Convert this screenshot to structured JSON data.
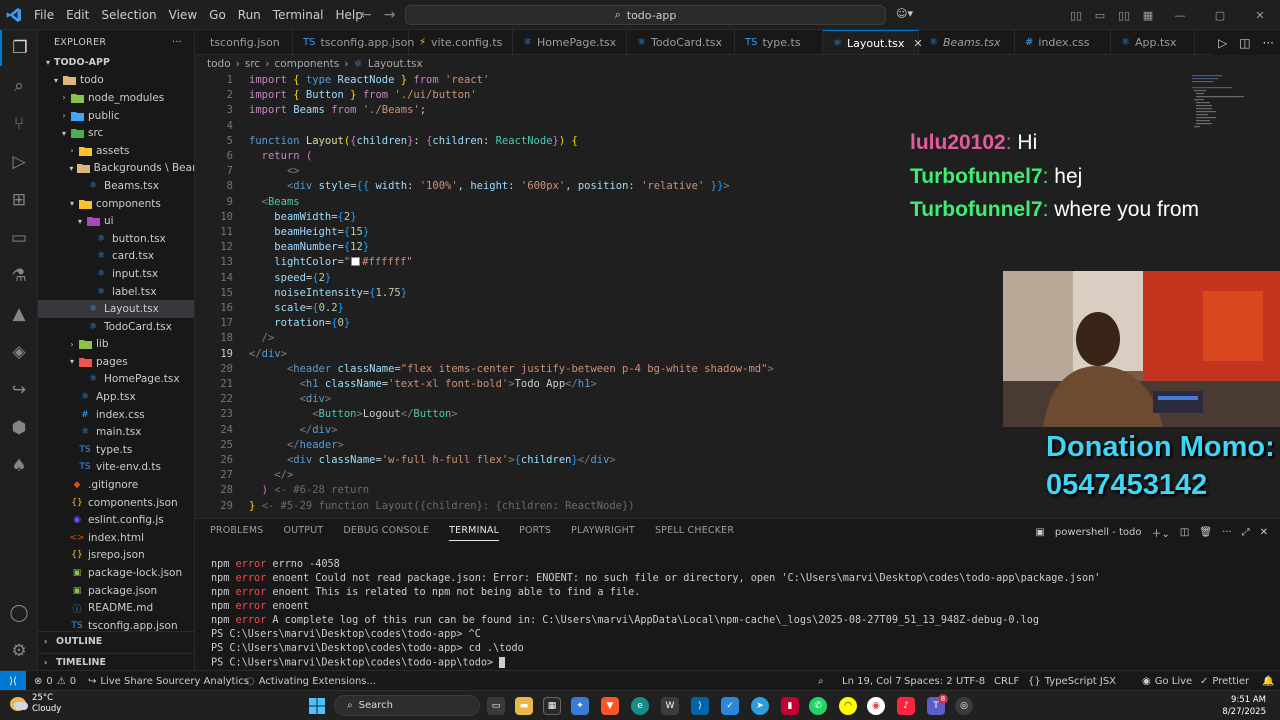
{
  "titlebar": {
    "menu": [
      "File",
      "Edit",
      "Selection",
      "View",
      "Go",
      "Run",
      "Terminal",
      "Help"
    ],
    "search": "todo-app"
  },
  "explorer": {
    "header": "EXPLORER",
    "project": "TODO-APP",
    "items": [
      {
        "label": "todo",
        "type": "folder",
        "open": true,
        "depth": 1,
        "color": "#dcb67a"
      },
      {
        "label": "node_modules",
        "type": "folder",
        "open": false,
        "depth": 2,
        "color": "#8bc34a"
      },
      {
        "label": "public",
        "type": "folder",
        "open": false,
        "depth": 2,
        "color": "#42a5f5"
      },
      {
        "label": "src",
        "type": "folder",
        "open": true,
        "depth": 2,
        "color": "#4caf50"
      },
      {
        "label": "assets",
        "type": "folder",
        "open": false,
        "depth": 3,
        "color": "#fbc02d"
      },
      {
        "label": "Backgrounds \\ Beams",
        "type": "folder",
        "open": true,
        "depth": 3,
        "color": "#dcb67a"
      },
      {
        "label": "Beams.tsx",
        "type": "file",
        "depth": 4,
        "color": "#3b9bf0",
        "glyph": "⚛"
      },
      {
        "label": "components",
        "type": "folder",
        "open": true,
        "depth": 3,
        "color": "#fbc02d"
      },
      {
        "label": "ui",
        "type": "folder",
        "open": true,
        "depth": 4,
        "color": "#ab47bc"
      },
      {
        "label": "button.tsx",
        "type": "file",
        "depth": 5,
        "color": "#3b9bf0",
        "glyph": "⚛"
      },
      {
        "label": "card.tsx",
        "type": "file",
        "depth": 5,
        "color": "#3b9bf0",
        "glyph": "⚛"
      },
      {
        "label": "input.tsx",
        "type": "file",
        "depth": 5,
        "color": "#3b9bf0",
        "glyph": "⚛"
      },
      {
        "label": "label.tsx",
        "type": "file",
        "depth": 5,
        "color": "#3b9bf0",
        "glyph": "⚛"
      },
      {
        "label": "Layout.tsx",
        "type": "file",
        "depth": 4,
        "color": "#3b9bf0",
        "glyph": "⚛",
        "selected": true
      },
      {
        "label": "TodoCard.tsx",
        "type": "file",
        "depth": 4,
        "color": "#3b9bf0",
        "glyph": "⚛"
      },
      {
        "label": "lib",
        "type": "folder",
        "open": false,
        "depth": 3,
        "color": "#8bc34a"
      },
      {
        "label": "pages",
        "type": "folder",
        "open": true,
        "depth": 3,
        "color": "#ef5350"
      },
      {
        "label": "HomePage.tsx",
        "type": "file",
        "depth": 4,
        "color": "#3b9bf0",
        "glyph": "⚛"
      },
      {
        "label": "App.tsx",
        "type": "file",
        "depth": 3,
        "color": "#3b9bf0",
        "glyph": "⚛"
      },
      {
        "label": "index.css",
        "type": "file",
        "depth": 3,
        "color": "#42a5f5",
        "glyph": "#"
      },
      {
        "label": "main.tsx",
        "type": "file",
        "depth": 3,
        "color": "#3b9bf0",
        "glyph": "⚛"
      },
      {
        "label": "type.ts",
        "type": "file",
        "depth": 3,
        "color": "#3b9bf0",
        "glyph": "TS"
      },
      {
        "label": "vite-env.d.ts",
        "type": "file",
        "depth": 3,
        "color": "#3b9bf0",
        "glyph": "TS"
      },
      {
        "label": ".gitignore",
        "type": "file",
        "depth": 2,
        "color": "#e64a19",
        "glyph": "◆"
      },
      {
        "label": "components.json",
        "type": "file",
        "depth": 2,
        "color": "#fbc02d",
        "glyph": "{}"
      },
      {
        "label": "eslint.config.js",
        "type": "file",
        "depth": 2,
        "color": "#7c4dff",
        "glyph": "◉"
      },
      {
        "label": "index.html",
        "type": "file",
        "depth": 2,
        "color": "#e65100",
        "glyph": "<>"
      },
      {
        "label": "jsrepo.json",
        "type": "file",
        "depth": 2,
        "color": "#fbc02d",
        "glyph": "{}"
      },
      {
        "label": "package-lock.json",
        "type": "file",
        "depth": 2,
        "color": "#8bc34a",
        "glyph": "▣"
      },
      {
        "label": "package.json",
        "type": "file",
        "depth": 2,
        "color": "#8bc34a",
        "glyph": "▣"
      },
      {
        "label": "README.md",
        "type": "file",
        "depth": 2,
        "color": "#42a5f5",
        "glyph": "ⓘ"
      },
      {
        "label": "tsconfig.app.json",
        "type": "file",
        "depth": 2,
        "color": "#3b9bf0",
        "glyph": "TS"
      }
    ],
    "outline": "OUTLINE",
    "timeline": "TIMELINE"
  },
  "tabs": [
    {
      "label": "tsconfig.json",
      "icon": "",
      "color": "#3b9bf0",
      "width": 98
    },
    {
      "label": "tsconfig.app.json",
      "icon": "TS",
      "color": "#3b9bf0",
      "width": 116
    },
    {
      "label": "vite.config.ts",
      "icon": "⚡",
      "color": "#fbc02d",
      "width": 104
    },
    {
      "label": "HomePage.tsx",
      "icon": "⚛",
      "color": "#3b9bf0",
      "width": 114
    },
    {
      "label": "TodoCard.tsx",
      "icon": "⚛",
      "color": "#3b9bf0",
      "width": 108
    },
    {
      "label": "type.ts",
      "icon": "TS",
      "color": "#3b9bf0",
      "width": 88
    },
    {
      "label": "Layout.tsx",
      "icon": "⚛",
      "color": "#3b9bf0",
      "width": 96,
      "active": true
    },
    {
      "label": "Beams.tsx",
      "icon": "⚛",
      "color": "#3b9bf0",
      "width": 96,
      "italic": true
    },
    {
      "label": "index.css",
      "icon": "#",
      "color": "#42a5f5",
      "width": 96
    },
    {
      "label": "App.tsx",
      "icon": "⚛",
      "color": "#3b9bf0",
      "width": 84
    }
  ],
  "breadcrumb": [
    "todo",
    "src",
    "components",
    "Layout.tsx"
  ],
  "editor": {
    "current_line": 19,
    "lines": [
      [
        [
          "kw",
          "import "
        ],
        [
          "br1",
          "{ "
        ],
        [
          "kb",
          "type "
        ],
        [
          "attr",
          "ReactNode"
        ],
        [
          "br1",
          " }"
        ],
        [
          "kw",
          " from "
        ],
        [
          "str",
          "'react'"
        ]
      ],
      [
        [
          "kw",
          "import "
        ],
        [
          "br1",
          "{ "
        ],
        [
          "attr",
          "Button"
        ],
        [
          "br1",
          " }"
        ],
        [
          "kw",
          " from "
        ],
        [
          "str",
          "'./ui/button'"
        ]
      ],
      [
        [
          "kw",
          "import "
        ],
        [
          "attr",
          "Beams"
        ],
        [
          "kw",
          " from "
        ],
        [
          "str",
          "'./Beams'"
        ],
        [
          "txt",
          ";"
        ]
      ],
      [],
      [
        [
          "kb",
          "function "
        ],
        [
          "fn",
          "Layout"
        ],
        [
          "br1",
          "("
        ],
        [
          "br2",
          "{"
        ],
        [
          "attr",
          "children"
        ],
        [
          "br2",
          "}"
        ],
        [
          "txt",
          ": "
        ],
        [
          "br2",
          "{"
        ],
        [
          "attr",
          "children"
        ],
        [
          "txt",
          ": "
        ],
        [
          "cmp",
          "ReactNode"
        ],
        [
          "br2",
          "}"
        ],
        [
          "br1",
          ")"
        ],
        [
          "txt",
          " "
        ],
        [
          "br1",
          "{"
        ]
      ],
      [
        [
          "txt",
          "  "
        ],
        [
          "kw",
          "return "
        ],
        [
          "br2",
          "("
        ]
      ],
      [
        [
          "txt",
          "      "
        ],
        [
          "gray",
          "<>"
        ]
      ],
      [
        [
          "txt",
          "      "
        ],
        [
          "gray",
          "<"
        ],
        [
          "tag",
          "div"
        ],
        [
          "txt",
          " "
        ],
        [
          "attr",
          "style"
        ],
        [
          "txt",
          "="
        ],
        [
          "br3",
          "{{ "
        ],
        [
          "attr",
          "width"
        ],
        [
          "txt",
          ": "
        ],
        [
          "str",
          "'100%'"
        ],
        [
          "txt",
          ", "
        ],
        [
          "attr",
          "height"
        ],
        [
          "txt",
          ": "
        ],
        [
          "str",
          "'600px'"
        ],
        [
          "txt",
          ", "
        ],
        [
          "attr",
          "position"
        ],
        [
          "txt",
          ": "
        ],
        [
          "str",
          "'relative'"
        ],
        [
          "br3",
          " }}"
        ],
        [
          "gray",
          ">"
        ]
      ],
      [
        [
          "txt",
          "  "
        ],
        [
          "gray",
          "<"
        ],
        [
          "cmp",
          "Beams"
        ]
      ],
      [
        [
          "txt",
          "    "
        ],
        [
          "attr",
          "beamWidth"
        ],
        [
          "txt",
          "="
        ],
        [
          "br3",
          "{"
        ],
        [
          "num",
          "2"
        ],
        [
          "br3",
          "}"
        ]
      ],
      [
        [
          "txt",
          "    "
        ],
        [
          "attr",
          "beamHeight"
        ],
        [
          "txt",
          "="
        ],
        [
          "br3",
          "{"
        ],
        [
          "num",
          "15"
        ],
        [
          "br3",
          "}"
        ]
      ],
      [
        [
          "txt",
          "    "
        ],
        [
          "attr",
          "beamNumber"
        ],
        [
          "txt",
          "="
        ],
        [
          "br3",
          "{"
        ],
        [
          "num",
          "12"
        ],
        [
          "br3",
          "}"
        ]
      ],
      [
        [
          "txt",
          "    "
        ],
        [
          "attr",
          "lightColor"
        ],
        [
          "txt",
          "="
        ],
        [
          "str",
          "\""
        ],
        [
          "swatch",
          ""
        ],
        [
          "str",
          "#ffffff\""
        ]
      ],
      [
        [
          "txt",
          "    "
        ],
        [
          "attr",
          "speed"
        ],
        [
          "txt",
          "="
        ],
        [
          "br3",
          "{"
        ],
        [
          "num",
          "2"
        ],
        [
          "br3",
          "}"
        ]
      ],
      [
        [
          "txt",
          "    "
        ],
        [
          "attr",
          "noiseIntensity"
        ],
        [
          "txt",
          "="
        ],
        [
          "br3",
          "{"
        ],
        [
          "num",
          "1.75"
        ],
        [
          "br3",
          "}"
        ]
      ],
      [
        [
          "txt",
          "    "
        ],
        [
          "attr",
          "scale"
        ],
        [
          "txt",
          "="
        ],
        [
          "br3",
          "{"
        ],
        [
          "num",
          "0.2"
        ],
        [
          "br3",
          "}"
        ]
      ],
      [
        [
          "txt",
          "    "
        ],
        [
          "attr",
          "rotation"
        ],
        [
          "txt",
          "="
        ],
        [
          "br3",
          "{"
        ],
        [
          "num",
          "0"
        ],
        [
          "br3",
          "}"
        ]
      ],
      [
        [
          "txt",
          "  "
        ],
        [
          "gray",
          "/>"
        ]
      ],
      [
        [
          "gray",
          "</"
        ],
        [
          "tag",
          "div"
        ],
        [
          "gray",
          ">"
        ]
      ],
      [
        [
          "txt",
          "      "
        ],
        [
          "gray",
          "<"
        ],
        [
          "tag",
          "header"
        ],
        [
          "txt",
          " "
        ],
        [
          "attr",
          "className"
        ],
        [
          "txt",
          "="
        ],
        [
          "str",
          "\"flex items-center justify-between p-4 bg-white shadow-md\""
        ],
        [
          "gray",
          ">"
        ]
      ],
      [
        [
          "txt",
          "        "
        ],
        [
          "gray",
          "<"
        ],
        [
          "tag",
          "h1"
        ],
        [
          "txt",
          " "
        ],
        [
          "attr",
          "className"
        ],
        [
          "txt",
          "="
        ],
        [
          "str",
          "'text-xl font-bold'"
        ],
        [
          "gray",
          ">"
        ],
        [
          "txt",
          "Todo App"
        ],
        [
          "gray",
          "</"
        ],
        [
          "tag",
          "h1"
        ],
        [
          "gray",
          ">"
        ]
      ],
      [
        [
          "txt",
          "        "
        ],
        [
          "gray",
          "<"
        ],
        [
          "tag",
          "div"
        ],
        [
          "gray",
          ">"
        ]
      ],
      [
        [
          "txt",
          "          "
        ],
        [
          "gray",
          "<"
        ],
        [
          "cmp",
          "Button"
        ],
        [
          "gray",
          ">"
        ],
        [
          "txt",
          "Logout"
        ],
        [
          "gray",
          "</"
        ],
        [
          "cmp",
          "Button"
        ],
        [
          "gray",
          ">"
        ]
      ],
      [
        [
          "txt",
          "        "
        ],
        [
          "gray",
          "</"
        ],
        [
          "tag",
          "div"
        ],
        [
          "gray",
          ">"
        ]
      ],
      [
        [
          "txt",
          "      "
        ],
        [
          "gray",
          "</"
        ],
        [
          "tag",
          "header"
        ],
        [
          "gray",
          ">"
        ]
      ],
      [
        [
          "txt",
          "      "
        ],
        [
          "gray",
          "<"
        ],
        [
          "tag",
          "div"
        ],
        [
          "txt",
          " "
        ],
        [
          "attr",
          "className"
        ],
        [
          "txt",
          "="
        ],
        [
          "str",
          "'w-full h-full flex'"
        ],
        [
          "gray",
          ">"
        ],
        [
          "br3",
          "{"
        ],
        [
          "vv",
          "children"
        ],
        [
          "br3",
          "}"
        ],
        [
          "gray",
          "</"
        ],
        [
          "tag",
          "div"
        ],
        [
          "gray",
          ">"
        ]
      ],
      [
        [
          "txt",
          "    "
        ],
        [
          "gray",
          "</>"
        ]
      ],
      [
        [
          "txt",
          "  "
        ],
        [
          "br2",
          ")"
        ],
        [
          "ghost",
          " <- #6-28 return"
        ]
      ],
      [
        [
          "br1",
          "}"
        ],
        [
          "ghost",
          " <- #5-29 function Layout({children}: {children: ReactNode})"
        ]
      ]
    ]
  },
  "panel": {
    "tabs": [
      "PROBLEMS",
      "OUTPUT",
      "DEBUG CONSOLE",
      "TERMINAL",
      "PORTS",
      "PLAYWRIGHT",
      "SPELL CHECKER"
    ],
    "active_tab": "TERMINAL",
    "shell": "powershell - todo",
    "terminal": [
      {
        "kind": "err",
        "prefix": "npm ",
        "tag": "error",
        "text": " errno -4058"
      },
      {
        "kind": "err",
        "prefix": "npm ",
        "tag": "error",
        "text": " enoent Could not read package.json: Error: ENOENT: no such file or directory, open 'C:\\Users\\marvi\\Desktop\\codes\\todo-app\\package.json'"
      },
      {
        "kind": "err",
        "prefix": "npm ",
        "tag": "error",
        "text": " enoent This is related to npm not being able to find a file."
      },
      {
        "kind": "err",
        "prefix": "npm ",
        "tag": "error",
        "text": " enoent"
      },
      {
        "kind": "err",
        "prefix": "npm ",
        "tag": "error",
        "text": " A complete log of this run can be found in: C:\\Users\\marvi\\AppData\\Local\\npm-cache\\_logs\\2025-08-27T09_51_13_948Z-debug-0.log"
      },
      {
        "kind": "ps",
        "text": "PS C:\\Users\\marvi\\Desktop\\codes\\todo-app> ^C"
      },
      {
        "kind": "ps",
        "text": "PS C:\\Users\\marvi\\Desktop\\codes\\todo-app> cd .\\todo"
      },
      {
        "kind": "ps",
        "text": "PS C:\\Users\\marvi\\Desktop\\codes\\todo-app\\todo> ",
        "cursor": true
      }
    ]
  },
  "statusbar": {
    "errors": "0",
    "warnings": "0",
    "liveshare": "Live Share",
    "sourcery": "Sourcery Analytics",
    "activating": "Activating Extensions...",
    "position": "Ln 19, Col 7",
    "spaces": "Spaces: 2",
    "encoding": "UTF-8",
    "eol": "CRLF",
    "language": "TypeScript JSX",
    "golive": "Go Live",
    "prettier": "Prettier"
  },
  "taskbar": {
    "temp": "25°C",
    "weather": "Cloudy",
    "search": "Search",
    "time": "9:51 AM",
    "date": "8/27/2025",
    "badge": "8"
  },
  "stream": {
    "chat": [
      {
        "user": "lulu20102",
        "message": "Hi",
        "color": "#e45c9e"
      },
      {
        "user": "Turbofunnel7",
        "message": "hej",
        "color": "#41ec75"
      },
      {
        "user": "Turbofunnel7",
        "message": "where you from",
        "color": "#41ec75"
      }
    ],
    "donation_title": "Donation Momo:",
    "donation_number": "0547453142"
  }
}
